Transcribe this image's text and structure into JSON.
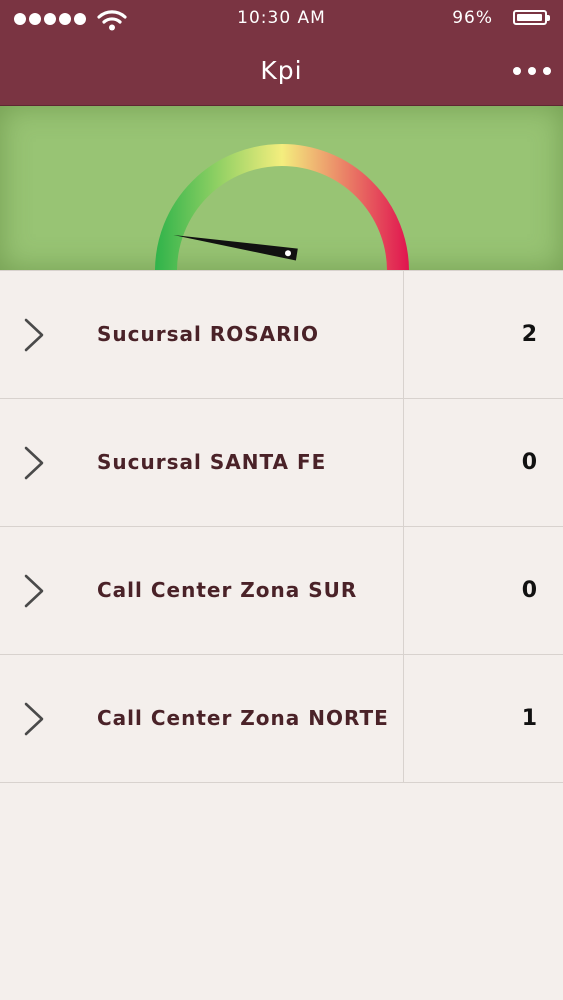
{
  "status_bar": {
    "time": "10:30 AM",
    "battery_percent": "96%",
    "signal_bars": 5,
    "battery_level": 0.96
  },
  "nav": {
    "title": "Kpi",
    "more_icon": "more-horizontal-icon"
  },
  "gauge": {
    "needle_fraction": 0.05,
    "colors": {
      "low": "#2fb34a",
      "mid": "#f4ee7e",
      "high": "#e0144f"
    }
  },
  "kpi_items": [
    {
      "label": "Sucursal ROSARIO",
      "value": "2"
    },
    {
      "label": "Sucursal SANTA FE",
      "value": "0"
    },
    {
      "label": "Call Center Zona SUR",
      "value": "0"
    },
    {
      "label": "Call Center Zona NORTE",
      "value": "1"
    }
  ],
  "theme": {
    "header_bg": "#7a3442",
    "panel_bg": "#98c474",
    "list_bg": "#f4efec",
    "label_color": "#4a2228"
  }
}
